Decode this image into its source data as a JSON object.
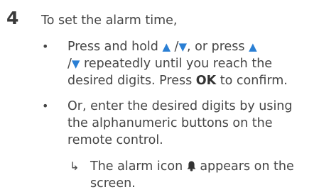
{
  "step": {
    "number": "4",
    "intro": "To set the alarm time,"
  },
  "bullet1": {
    "dot": "•",
    "line1_a": "Press and hold ",
    "up_arrow": "▲",
    "line1_b": " /",
    "down_arrow": "▼",
    "line1_c": ", or press ",
    "line2_a": "/",
    "line2_b": " repeatedly until you reach the",
    "line3_a": "desired digits. Press ",
    "line3_ok": "OK",
    "line3_b": " to confirm."
  },
  "bullet2": {
    "dot": "•",
    "line1": "Or, enter the desired digits by using",
    "line2": "the alphanumeric buttons on the",
    "line3": "remote control."
  },
  "result": {
    "arrow": "↳",
    "line1_a": "The alarm icon ",
    "line1_b": " appears on the",
    "line2": "screen."
  }
}
